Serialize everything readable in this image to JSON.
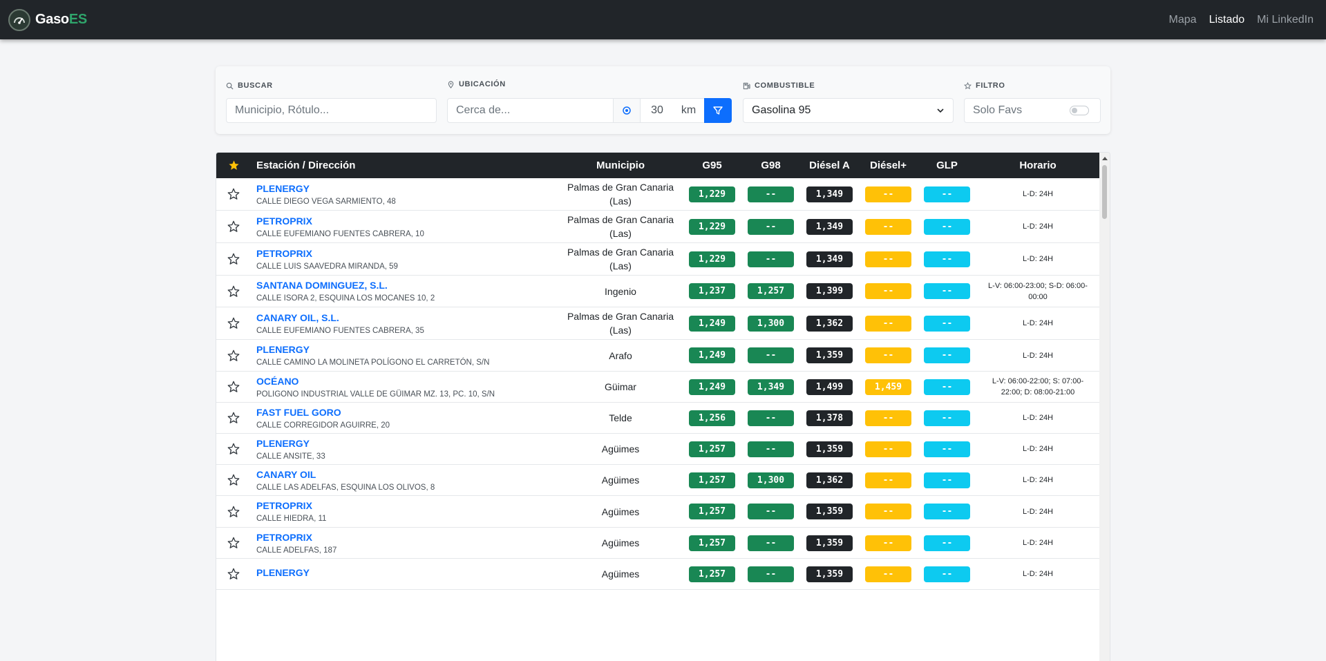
{
  "app": {
    "brand_part1": "Gaso",
    "brand_part2": "ES",
    "nav": [
      "Mapa",
      "Listado",
      "Mi LinkedIn"
    ]
  },
  "filters": {
    "search_label": "BUSCAR",
    "search_placeholder": "Municipio, Rótulo...",
    "location_label": "UBICACIÓN",
    "location_placeholder": "Cerca de...",
    "radius_value": "30",
    "radius_unit": "km",
    "fuel_label": "COMBUSTIBLE",
    "fuel_selected": "Gasolina 95",
    "filter_label": "FILTRO",
    "favs_label": "Solo Favs"
  },
  "table": {
    "headers": [
      "Estación / Dirección",
      "Municipio",
      "G95",
      "G98",
      "Diésel A",
      "Diésel+",
      "GLP",
      "Horario"
    ],
    "rows": [
      {
        "name": "PLENERGY",
        "address": "CALLE DIEGO VEGA SARMIENTO, 48",
        "municipio": "Palmas de Gran Canaria (Las)",
        "g95": "1,229",
        "g98": "--",
        "dsa": "1,349",
        "dsp": "--",
        "glp": "--",
        "horario": "L-D: 24H"
      },
      {
        "name": "PETROPRIX",
        "address": "CALLE EUFEMIANO FUENTES CABRERA, 10",
        "municipio": "Palmas de Gran Canaria (Las)",
        "g95": "1,229",
        "g98": "--",
        "dsa": "1,349",
        "dsp": "--",
        "glp": "--",
        "horario": "L-D: 24H"
      },
      {
        "name": "PETROPRIX",
        "address": "CALLE LUIS SAAVEDRA MIRANDA, 59",
        "municipio": "Palmas de Gran Canaria (Las)",
        "g95": "1,229",
        "g98": "--",
        "dsa": "1,349",
        "dsp": "--",
        "glp": "--",
        "horario": "L-D: 24H"
      },
      {
        "name": "SANTANA DOMINGUEZ, S.L.",
        "address": "CALLE ISORA 2, ESQUINA LOS MOCANES 10, 2",
        "municipio": "Ingenio",
        "g95": "1,237",
        "g98": "1,257",
        "dsa": "1,399",
        "dsp": "--",
        "glp": "--",
        "horario": "L-V: 06:00-23:00; S-D: 06:00-00:00"
      },
      {
        "name": "CANARY OIL, S.L.",
        "address": "CALLE EUFEMIANO FUENTES CABRERA, 35",
        "municipio": "Palmas de Gran Canaria (Las)",
        "g95": "1,249",
        "g98": "1,300",
        "dsa": "1,362",
        "dsp": "--",
        "glp": "--",
        "horario": "L-D: 24H"
      },
      {
        "name": "PLENERGY",
        "address": "CALLE CAMINO LA MOLINETA POLÍGONO EL CARRETÓN, S/N",
        "municipio": "Arafo",
        "g95": "1,249",
        "g98": "--",
        "dsa": "1,359",
        "dsp": "--",
        "glp": "--",
        "horario": "L-D: 24H"
      },
      {
        "name": "OCÉANO",
        "address": "POLIGONO INDUSTRIAL VALLE DE GÜIMAR MZ. 13, PC. 10, S/N",
        "municipio": "Güimar",
        "g95": "1,249",
        "g98": "1,349",
        "dsa": "1,499",
        "dsp": "1,459",
        "glp": "--",
        "horario": "L-V: 06:00-22:00; S: 07:00-22:00; D: 08:00-21:00"
      },
      {
        "name": "FAST FUEL GORO",
        "address": "CALLE CORREGIDOR AGUIRRE, 20",
        "municipio": "Telde",
        "g95": "1,256",
        "g98": "--",
        "dsa": "1,378",
        "dsp": "--",
        "glp": "--",
        "horario": "L-D: 24H"
      },
      {
        "name": "PLENERGY",
        "address": "CALLE ANSITE, 33",
        "municipio": "Agüimes",
        "g95": "1,257",
        "g98": "--",
        "dsa": "1,359",
        "dsp": "--",
        "glp": "--",
        "horario": "L-D: 24H"
      },
      {
        "name": "CANARY OIL",
        "address": "CALLE LAS ADELFAS, ESQUINA LOS OLIVOS, 8",
        "municipio": "Agüimes",
        "g95": "1,257",
        "g98": "1,300",
        "dsa": "1,362",
        "dsp": "--",
        "glp": "--",
        "horario": "L-D: 24H"
      },
      {
        "name": "PETROPRIX",
        "address": "CALLE HIEDRA, 11",
        "municipio": "Agüimes",
        "g95": "1,257",
        "g98": "--",
        "dsa": "1,359",
        "dsp": "--",
        "glp": "--",
        "horario": "L-D: 24H"
      },
      {
        "name": "PETROPRIX",
        "address": "CALLE ADELFAS, 187",
        "municipio": "Agüimes",
        "g95": "1,257",
        "g98": "--",
        "dsa": "1,359",
        "dsp": "--",
        "glp": "--",
        "horario": "L-D: 24H"
      },
      {
        "name": "PLENERGY",
        "address": "",
        "municipio": "Agüimes",
        "g95": "1,257",
        "g98": "--",
        "dsa": "1,359",
        "dsp": "--",
        "glp": "--",
        "horario": "L-D: 24H"
      }
    ]
  },
  "colors": {
    "navbar": "#212529",
    "link": "#0d6efd",
    "g95": "#198754",
    "g98": "#198754",
    "diesel_a": "#212529",
    "diesel_plus": "#ffc107",
    "glp": "#0dcaf0",
    "fav_star": "#ffc107"
  },
  "icons": {
    "brand": "gauge-icon",
    "search": "search-icon",
    "location": "map-pin-icon",
    "locate": "crosshair-icon",
    "filter": "funnel-icon",
    "fuel": "fuel-pump-icon",
    "favorite": "star-icon",
    "dropdown": "chevron-down-icon"
  }
}
